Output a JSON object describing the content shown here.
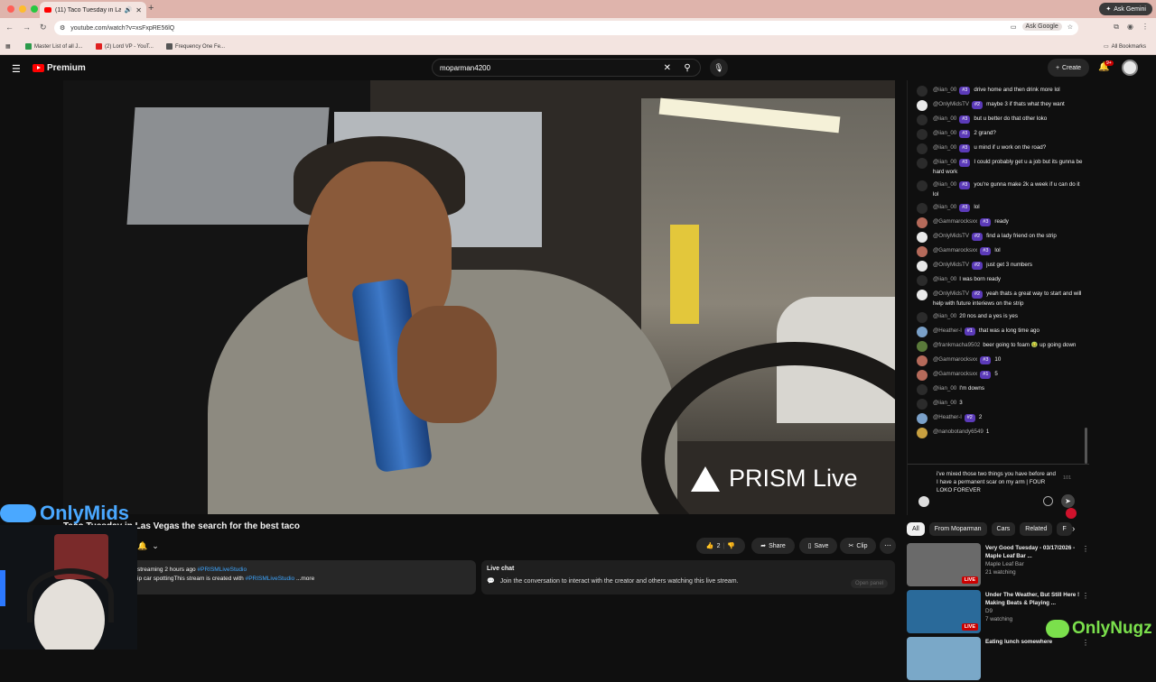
{
  "browser": {
    "tab_title": "(11) Taco Tuesday in Las",
    "url": "youtube.com/watch?v=xsFxpRE56lQ",
    "ask_gemini": "Ask Gemini",
    "ask_google": "Ask Google",
    "all_bookmarks": "All Bookmarks",
    "bookmarks": [
      "Master List of all J...",
      "(2) Lord VP - YouT...",
      "Frequency One Fe..."
    ]
  },
  "youtube": {
    "logo_text": "Premium",
    "search_value": "moparman4200",
    "create_label": "Create",
    "notification_count": "9+"
  },
  "video": {
    "watermark": "PRISM Live",
    "title": "Taco Tuesday in Las Vegas the search for the best taco",
    "likes": "2",
    "share_label": "Share",
    "save_label": "Save",
    "clip_label": "Clip",
    "description_line1": "streaming 2 hours ago",
    "description_hashtag1": "#PRISMLiveStudio",
    "description_line2": "ip car spottingThis stream is created with",
    "description_hashtag2": "#PRISMLiveStudio",
    "description_more": "...more"
  },
  "live_chat_box": {
    "title": "Live chat",
    "text": "Join the conversation to interact with the creator and others watching this live stream.",
    "open_panel": "Open panel"
  },
  "chat": {
    "messages": [
      {
        "user": "@iian_00",
        "badge": "#3",
        "text": "drive home and then drink more lol",
        "avatar": "#2b2b2b"
      },
      {
        "user": "@OnlyMidsTV",
        "badge": "#2",
        "text": "maybe 3 if thats what they want",
        "avatar": "#e9e9e9"
      },
      {
        "user": "@iian_00",
        "badge": "#3",
        "text": "but u better do that other loko",
        "avatar": "#2b2b2b"
      },
      {
        "user": "@iian_00",
        "badge": "#3",
        "text": "2 grand?",
        "avatar": "#2b2b2b"
      },
      {
        "user": "@iian_00",
        "badge": "#3",
        "text": "u mind if u work on the road?",
        "avatar": "#2b2b2b"
      },
      {
        "user": "@iian_00",
        "badge": "#3",
        "text": "I could probably get u a job but its gunna be hard work",
        "avatar": "#2b2b2b"
      },
      {
        "user": "@iian_00",
        "badge": "#3",
        "text": "you're gunna make 2k a week if u can do it lol",
        "avatar": "#2b2b2b"
      },
      {
        "user": "@iian_00",
        "badge": "#3",
        "text": "lol",
        "avatar": "#2b2b2b"
      },
      {
        "user": "@Gammarocksxx",
        "badge": "#3",
        "text": "ready",
        "avatar": "#b56a5a"
      },
      {
        "user": "@OnlyMidsTV",
        "badge": "#2",
        "text": "find a lady friend on the strip",
        "avatar": "#e9e9e9"
      },
      {
        "user": "@Gammarocksxx",
        "badge": "#3",
        "text": "lol",
        "avatar": "#b56a5a"
      },
      {
        "user": "@OnlyMidsTV",
        "badge": "#2",
        "text": "just get 3 numbers",
        "avatar": "#e9e9e9"
      },
      {
        "user": "@iian_00",
        "badge": "",
        "text": "I was born ready",
        "avatar": "#2b2b2b"
      },
      {
        "user": "@OnlyMidsTV",
        "badge": "#2",
        "text": "yeah thats a great way to start and will help with future interiews on the strip",
        "avatar": "#e9e9e9"
      },
      {
        "user": "@iian_00",
        "badge": "",
        "text": "20 nos and a yes is yes",
        "avatar": "#2b2b2b"
      },
      {
        "user": "@Heather-l",
        "badge": "#1",
        "text": "that was a long time ago",
        "avatar": "#7aa0c8"
      },
      {
        "user": "@frankmacha9502",
        "badge": "",
        "text": "beer going to foam 🤢 up going down",
        "avatar": "#5a7a3a"
      },
      {
        "user": "@Gammarocksxx",
        "badge": "#3",
        "text": "10",
        "avatar": "#b56a5a"
      },
      {
        "user": "@Gammarocksxx",
        "badge": "#1",
        "text": "5",
        "avatar": "#b56a5a"
      },
      {
        "user": "@iian_00",
        "badge": "",
        "text": "I'm downs",
        "avatar": "#2b2b2b"
      },
      {
        "user": "@iian_00",
        "badge": "",
        "text": "3",
        "avatar": "#2b2b2b"
      },
      {
        "user": "@Heather-l",
        "badge": "#2",
        "text": "2",
        "avatar": "#7aa0c8"
      },
      {
        "user": "@nanobotandy6549",
        "badge": "",
        "text": "1",
        "avatar": "#c8a040"
      }
    ],
    "input_text": "i've mixed those two things you have before and I have a permanent scar on my arm | FOUR LOKO FOREVER",
    "char_count": "101"
  },
  "chips": [
    "All",
    "From Moparman",
    "Cars",
    "Related",
    "F"
  ],
  "recommendations": [
    {
      "title": "Very Good Tuesday - 03/17/2026 - Maple Leaf Bar ...",
      "channel": "Maple Leaf Bar",
      "meta": "21 watching",
      "live": "LIVE",
      "thumb": "#6a6a6a"
    },
    {
      "title": "Under The Weather, But Still Here ! Making Beats & Playing ...",
      "channel": "D9",
      "meta": "7 watching",
      "live": "LIVE",
      "thumb": "#2a6a9a"
    },
    {
      "title": "Eating lunch somewhere",
      "channel": "",
      "meta": "",
      "live": "",
      "thumb": "#7aa8c8"
    }
  ],
  "overlays": {
    "brand_left": "OnlyMids",
    "brand_right": "OnlyNugz"
  }
}
